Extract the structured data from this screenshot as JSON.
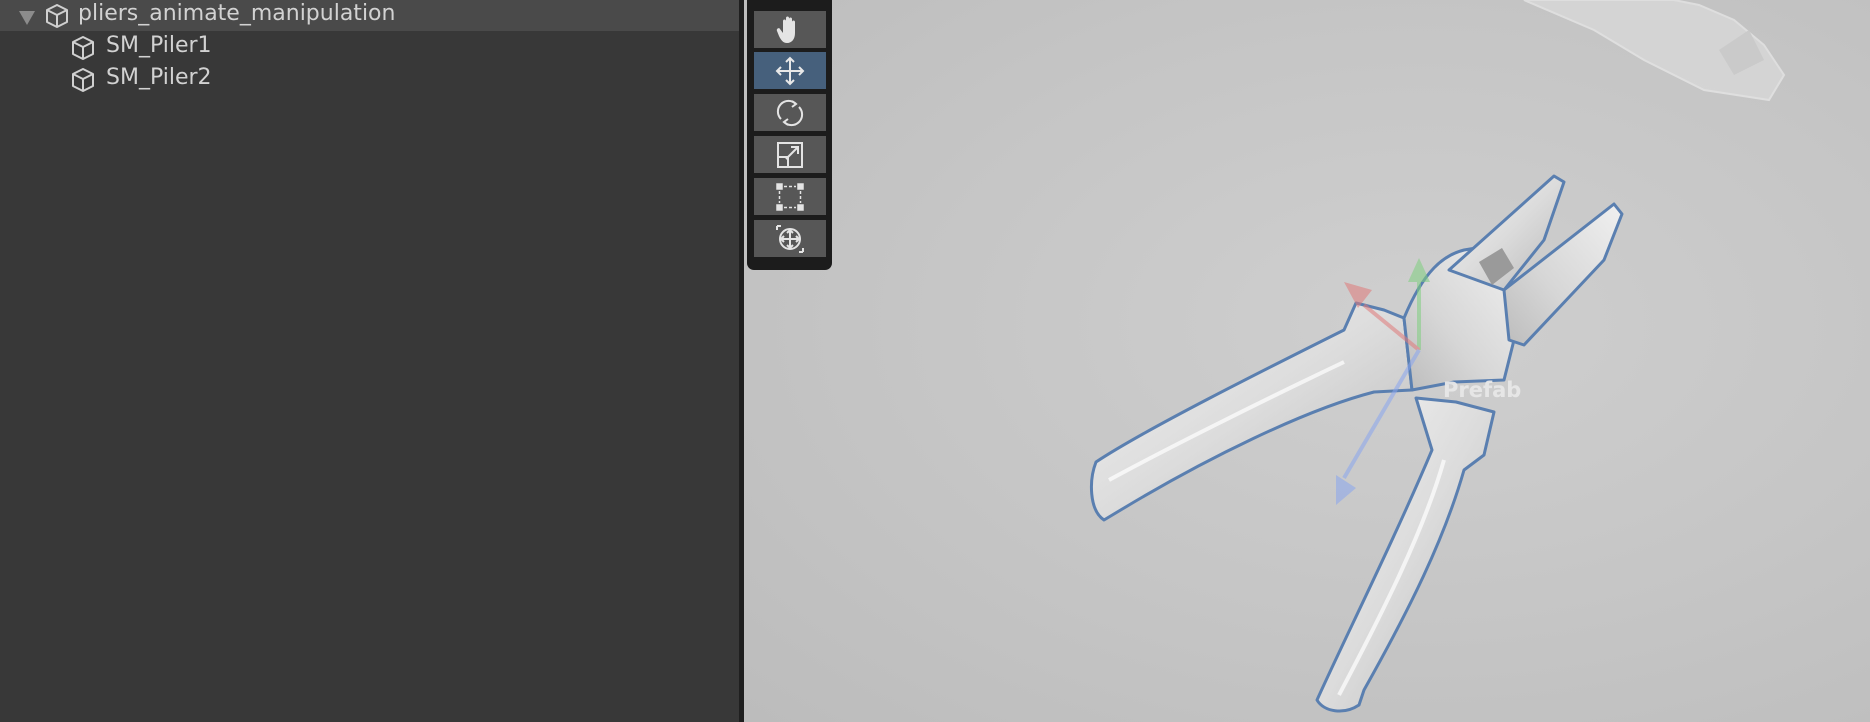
{
  "hierarchy": {
    "root": {
      "label": "pliers_animate_manipulation",
      "expanded": true
    },
    "children": [
      {
        "label": "SM_Piler1"
      },
      {
        "label": "SM_Piler2"
      }
    ]
  },
  "toolbar": {
    "tools": [
      {
        "id": "view",
        "icon": "hand-icon",
        "active": false
      },
      {
        "id": "move",
        "icon": "move-arrows-icon",
        "active": true
      },
      {
        "id": "rotate",
        "icon": "rotate-icon",
        "active": false
      },
      {
        "id": "scale",
        "icon": "scale-icon",
        "active": false
      },
      {
        "id": "rect",
        "icon": "rect-transform-icon",
        "active": false
      },
      {
        "id": "transform",
        "icon": "transform-icon",
        "active": false
      }
    ]
  },
  "scene": {
    "object_label": "Prefab",
    "selection_outline_color": "#5a7fb0",
    "gizmo_colors": {
      "x": "#e07a7a",
      "y": "#7fcf7f",
      "z": "#8aa6ef"
    }
  }
}
